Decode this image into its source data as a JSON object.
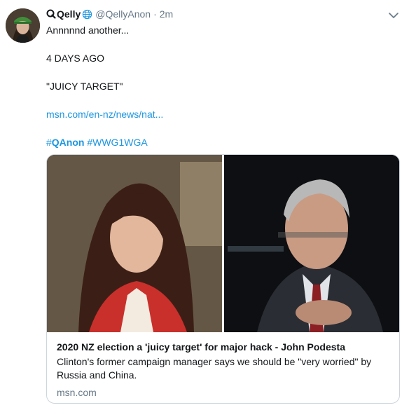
{
  "tweet": {
    "display_name": "Qelly",
    "handle": "@QellyAnon",
    "separator": "·",
    "time": "2m",
    "lines": {
      "l1": "Annnnnd another...",
      "l2": "4 DAYS AGO",
      "l3": "\"JUICY TARGET\"",
      "link": "msn.com/en-nz/news/nat..."
    },
    "hashtags": {
      "h1_prefix": "#",
      "h1_word": "QAnon",
      "h2": "#WWG1WGA"
    }
  },
  "card": {
    "title": "2020 NZ election a 'juicy target' for major hack - John Podesta",
    "description": "Clinton's former campaign manager says we should be \"very worried\" by Russia and China.",
    "domain": "msn.com"
  },
  "colors": {
    "link": "#1b95e0",
    "muted": "#657786",
    "text": "#14171a",
    "border": "#ccd6dd"
  },
  "icons": {
    "name_prefix": "q-icon",
    "name_suffix": "globe-icon",
    "menu": "chevron-down-icon"
  }
}
